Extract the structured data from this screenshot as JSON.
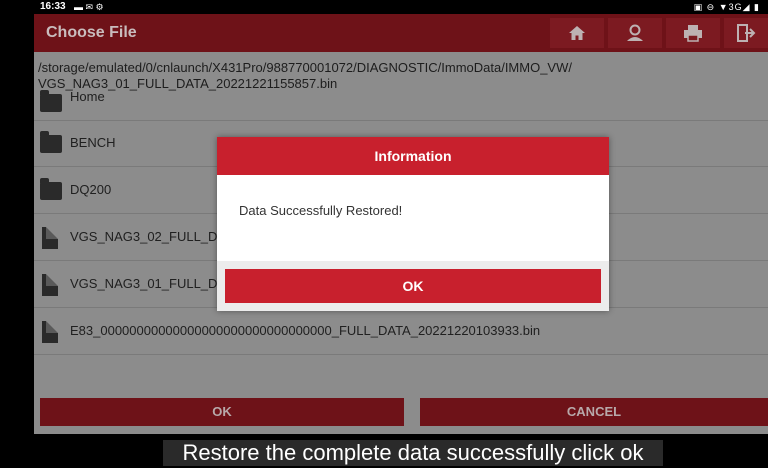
{
  "statusbar": {
    "time": "16:33",
    "left_icons": "▬ ✉ ⚙",
    "right_icons": "▣ ⊖ ▼3G◢ ▮"
  },
  "app": {
    "title": "Choose File",
    "toolbar_icons": [
      "home-icon",
      "user-icon",
      "print-icon",
      "exit-icon"
    ],
    "path_line1": "/storage/emulated/0/cnlaunch/X431Pro/988770001072/DIAGNOSTIC/ImmoData/IMMO_VW/",
    "path_line2": "VGS_NAG3_01_FULL_DATA_20221221155857.bin",
    "files": [
      {
        "name": "Home",
        "type": "folder"
      },
      {
        "name": "BENCH",
        "type": "folder"
      },
      {
        "name": "DQ200",
        "type": "folder"
      },
      {
        "name": "VGS_NAG3_02_FULL_D",
        "type": "file"
      },
      {
        "name": "VGS_NAG3_01_FULL_D",
        "type": "file"
      },
      {
        "name": "E83_00000000000000000000000000000000_FULL_DATA_20221220103933.bin",
        "type": "file"
      }
    ],
    "ok_label": "OK",
    "cancel_label": "CANCEL"
  },
  "dialog": {
    "title": "Information",
    "message": "Data Successfully Restored!",
    "ok_label": "OK"
  },
  "caption": "Restore the complete data successfully click ok",
  "colors": {
    "brand_red": "#c8202d",
    "dimmed_red": "#6e1218"
  }
}
